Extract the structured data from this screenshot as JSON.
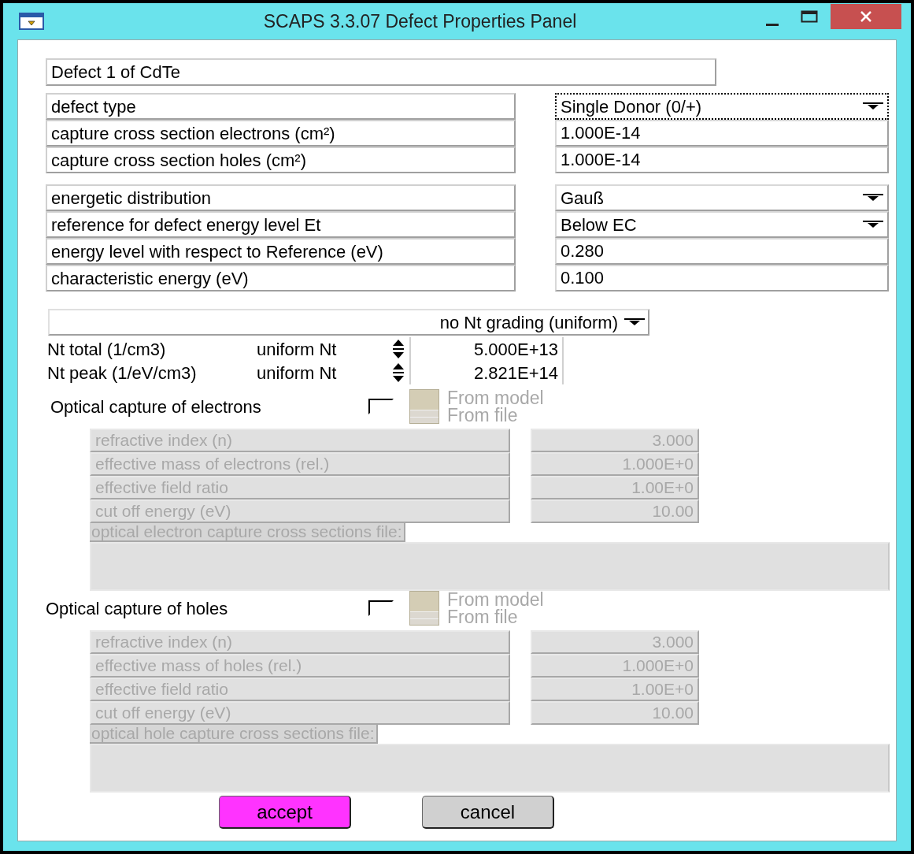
{
  "window": {
    "title": "SCAPS 3.3.07 Defect Properties Panel"
  },
  "defect_name": "Defect 1 of CdTe",
  "properties_group1": [
    {
      "label": "defect type",
      "kind": "dropdown",
      "value": "Single Donor (0/+)",
      "focused": true
    },
    {
      "label": "capture cross section electrons (cm²)",
      "kind": "input",
      "value": "1.000E-14",
      "focused": false
    },
    {
      "label": "capture cross section holes (cm²)",
      "kind": "input",
      "value": "1.000E-14",
      "focused": false
    }
  ],
  "properties_group2": [
    {
      "label": "energetic distribution",
      "kind": "dropdown",
      "value": "Gauß",
      "focused": false
    },
    {
      "label": "reference for defect energy level Et",
      "kind": "dropdown",
      "value": "Below EC",
      "focused": false
    },
    {
      "label": "energy level with respect to Reference (eV)",
      "kind": "input",
      "value": "0.280",
      "focused": false
    },
    {
      "label": "characteristic energy (eV)",
      "kind": "input",
      "value": "0.100",
      "focused": false
    }
  ],
  "grading": {
    "value": "no Nt grading (uniform)"
  },
  "densities": [
    {
      "label": "Nt total (1/cm3)",
      "mode": "uniform Nt",
      "value": "5.000E+13"
    },
    {
      "label": "Nt peak (1/eV/cm3)",
      "mode": "uniform Nt",
      "value": "2.821E+14"
    }
  ],
  "optical": [
    {
      "title": "Optical capture of electrons",
      "checked": false,
      "source_options": [
        "From model",
        "From file"
      ],
      "params": [
        {
          "label": "refractive index (n)",
          "value": "3.000"
        },
        {
          "label": "effective mass of electrons (rel.)",
          "value": "1.000E+0"
        },
        {
          "label": "effective field ratio",
          "value": "1.00E+0"
        },
        {
          "label": "cut off energy (eV)",
          "value": "10.00"
        }
      ],
      "file_label": "optical electron capture cross sections file:"
    },
    {
      "title": "Optical capture of holes",
      "checked": false,
      "source_options": [
        "From model",
        "From file"
      ],
      "params": [
        {
          "label": "refractive index (n)",
          "value": "3.000"
        },
        {
          "label": "effective mass of holes (rel.)",
          "value": "1.000E+0"
        },
        {
          "label": "effective field ratio",
          "value": "1.00E+0"
        },
        {
          "label": "cut off energy (eV)",
          "value": "10.00"
        }
      ],
      "file_label": "optical hole capture cross sections file:"
    }
  ],
  "buttons": [
    {
      "label": "accept",
      "kind": "primary"
    },
    {
      "label": "cancel",
      "kind": "secondary"
    }
  ]
}
